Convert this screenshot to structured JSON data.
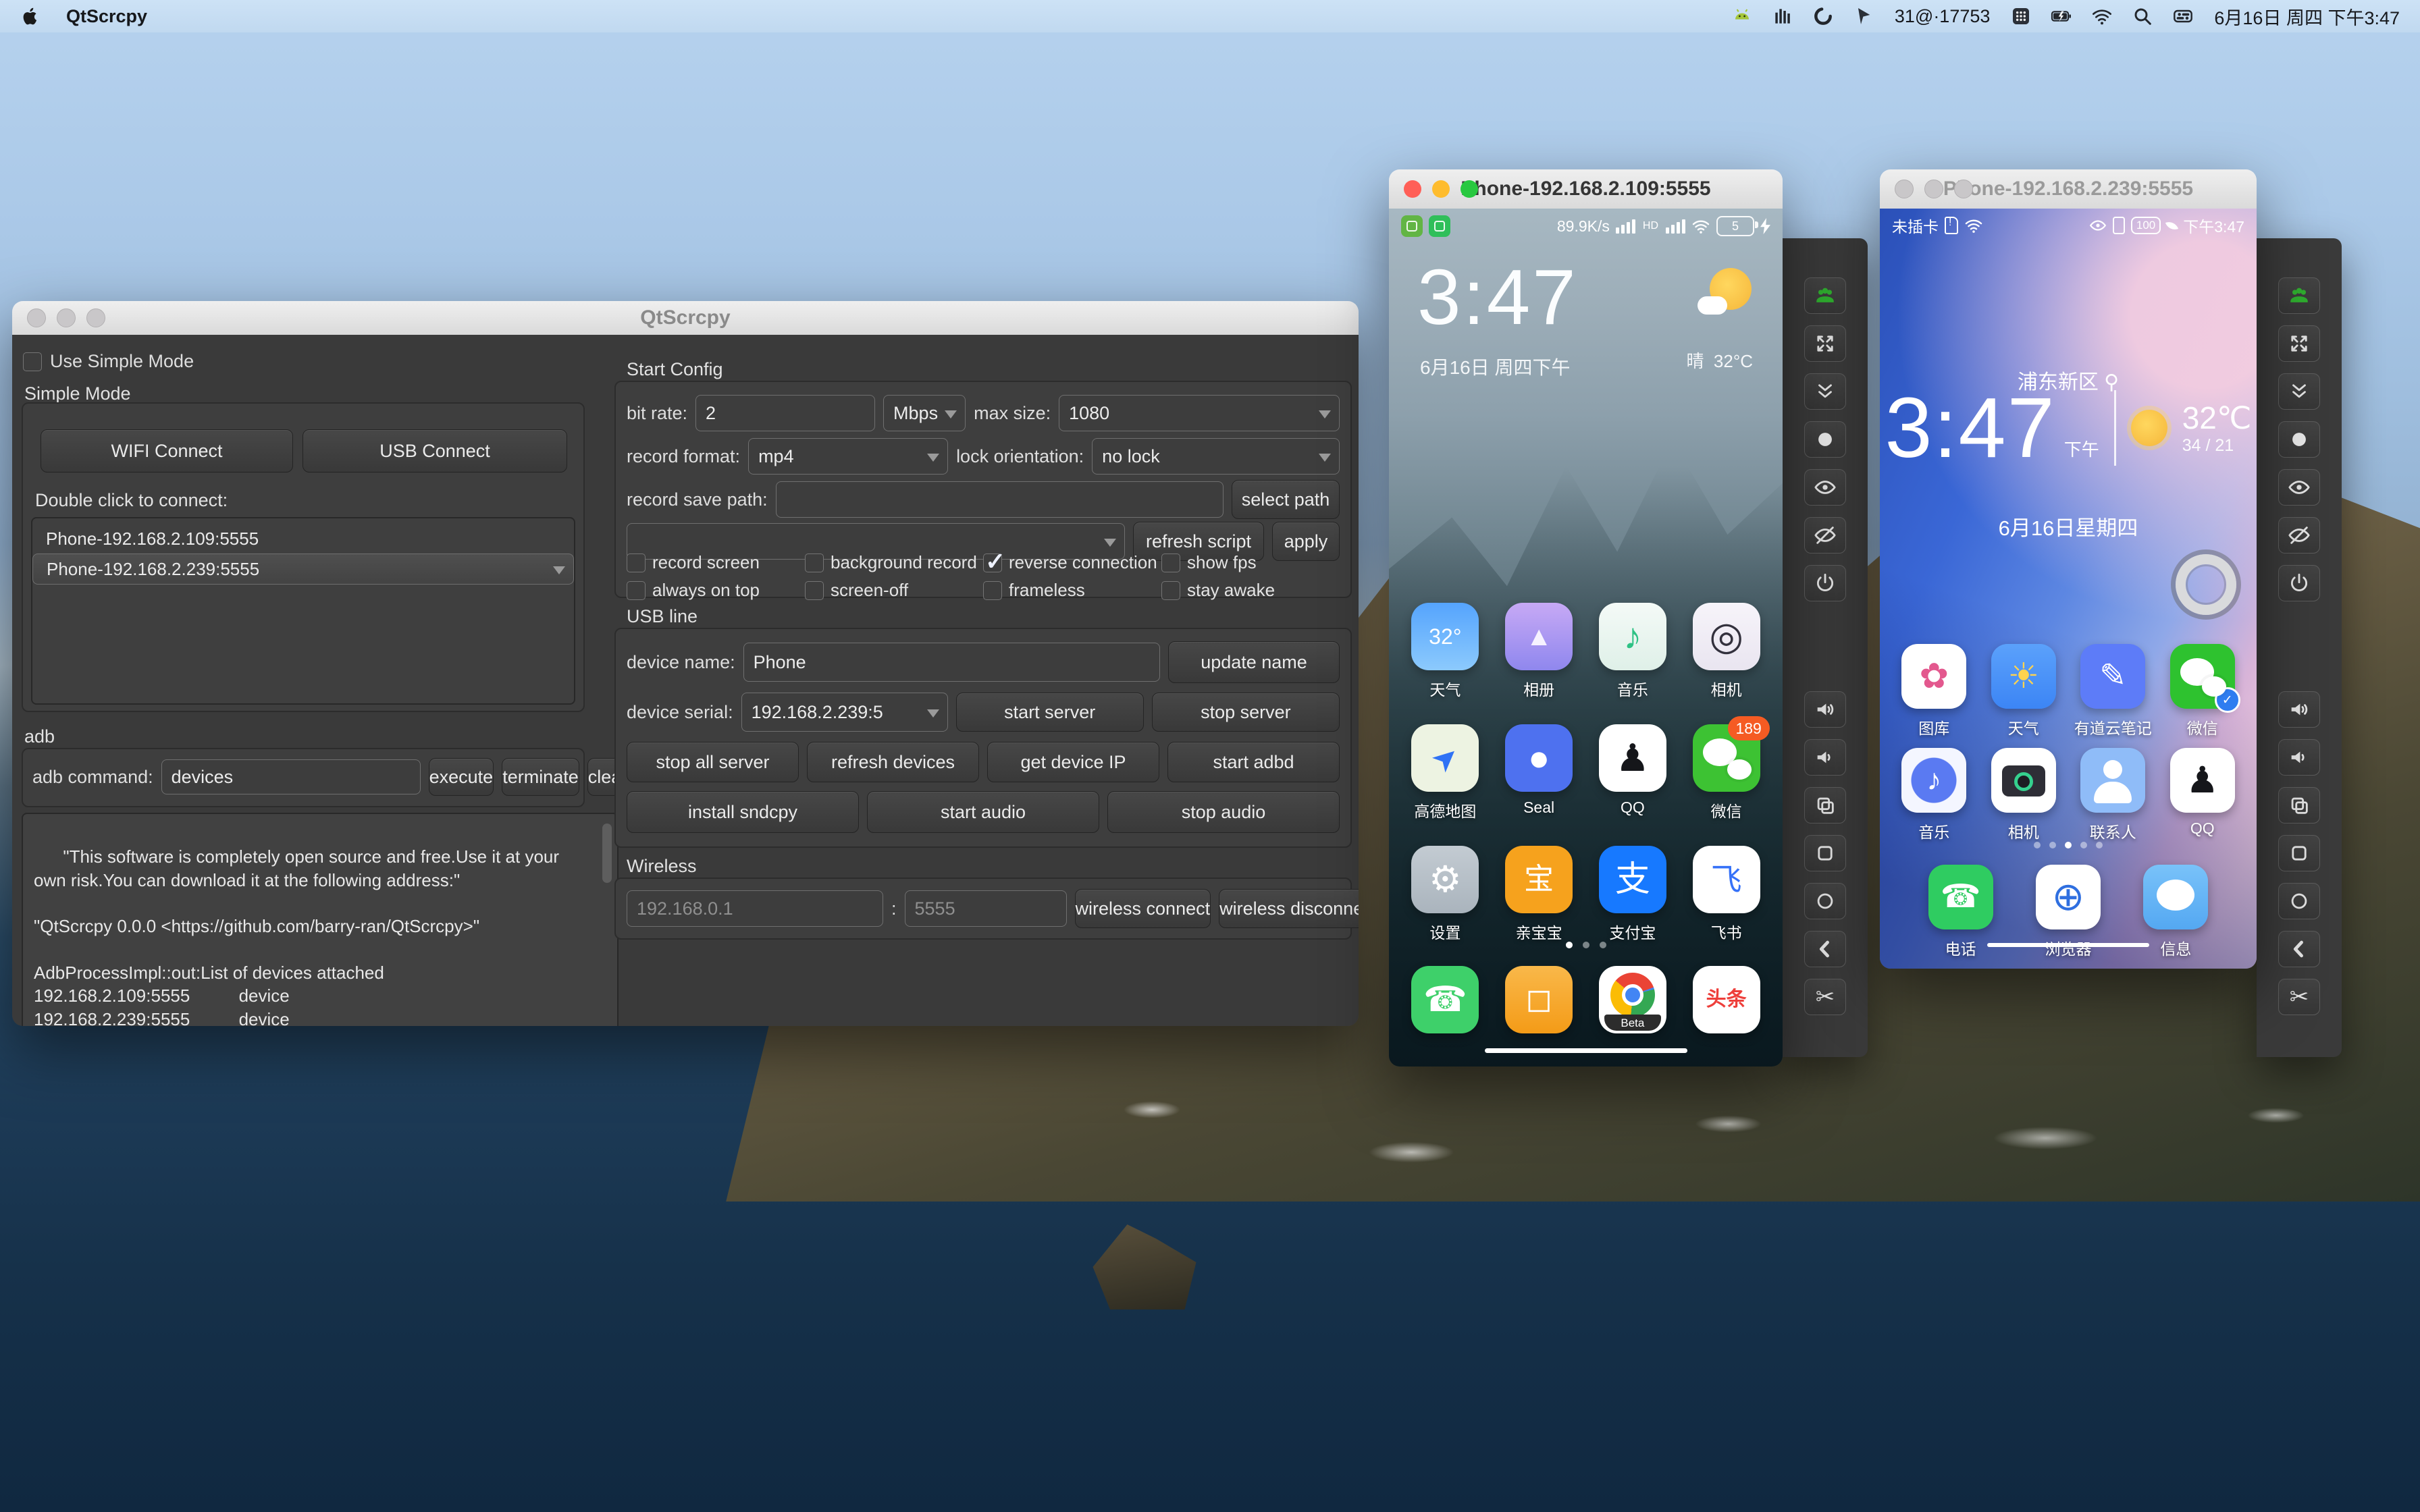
{
  "colors": {
    "traffic_red": "#ff5f57",
    "traffic_yellow": "#febc2e",
    "traffic_green": "#28c840",
    "wechat_green": "#2dc100",
    "panel_dark": "#3a3a3a",
    "menubar_tint": "#c8ddf2"
  },
  "menu_bar": {
    "app_name": "QtScrcpy",
    "proxy_status": "31@·17753",
    "clock": "6月16日 周四 下午3:47",
    "icons_left_of_status": [
      "android-icon",
      "equalizer-icon",
      "swirl-icon",
      "cursor-icon"
    ],
    "icons_right_of_status": [
      "grid-icon",
      "battery-icon",
      "wifi-icon",
      "search-icon",
      "control-center-icon"
    ]
  },
  "main_window": {
    "title": "QtScrcpy",
    "simple": {
      "use_simple_mode": "Use Simple Mode",
      "simple_mode": "Simple Mode",
      "wifi_connect": "WIFI Connect",
      "usb_connect": "USB Connect",
      "double_click": "Double click to connect:",
      "devices": [
        "Phone-192.168.2.109:5555",
        "Phone-192.168.2.239:5555"
      ],
      "selected_index": 1
    },
    "adb": {
      "section": "adb",
      "command_label": "adb command:",
      "command_value": "devices",
      "execute": "execute",
      "terminate": "terminate",
      "clear": "clear",
      "log": [
        "\"This software is completely open source and free.Use it at your own risk.You can download it at the following address:\"",
        "",
        "\"QtScrcpy 0.0.0 <https://github.com/barry-ran/QtScrcpy>\"",
        "",
        "AdbProcessImpl::out:List of devices attached",
        "192.168.2.109:5555          device",
        "192.168.2.239:5555          device"
      ]
    },
    "config": {
      "section": "Start Config",
      "bit_rate_label": "bit rate:",
      "bit_rate": "2",
      "bit_rate_unit": "Mbps",
      "max_size_label": "max size:",
      "max_size": "1080",
      "record_format_label": "record format:",
      "record_format": "mp4",
      "lock_orientation_label": "lock orientation:",
      "lock_orientation": "no lock",
      "record_save_path_label": "record save path:",
      "select_path": "select path",
      "refresh_script": "refresh script",
      "apply": "apply",
      "checks": [
        {
          "label": "record screen",
          "checked": false
        },
        {
          "label": "background record",
          "checked": false
        },
        {
          "label": "reverse connection",
          "checked": true
        },
        {
          "label": "show fps",
          "checked": false
        },
        {
          "label": "always on top",
          "checked": false
        },
        {
          "label": "screen-off",
          "checked": false
        },
        {
          "label": "frameless",
          "checked": false
        },
        {
          "label": "stay awake",
          "checked": false
        }
      ]
    },
    "usb": {
      "section": "USB line",
      "device_name_label": "device name:",
      "device_name": "Phone",
      "update_name": "update name",
      "device_serial_label": "device serial:",
      "device_serial": "192.168.2.239:5",
      "row2_buttons": [
        "start server",
        "stop server"
      ],
      "row3_buttons": [
        "stop all server",
        "refresh devices",
        "get device IP",
        "start adbd"
      ],
      "row4_buttons": [
        "install sndcpy",
        "start audio",
        "stop audio"
      ]
    },
    "wireless": {
      "section": "Wireless",
      "ip_placeholder": "192.168.0.1",
      "port_placeholder": "5555",
      "connect": "wireless connect",
      "disconnect": "wireless disconnect"
    }
  },
  "phone1": {
    "title": "Phone-192.168.2.109:5555",
    "status": {
      "speed": "89.9K/s",
      "hd": "HD",
      "battery": "5"
    },
    "clock": "3:47",
    "date": "6月16日 周四下午",
    "weather_cond": "晴",
    "weather_temp": "32°C",
    "apps": [
      {
        "name": "weather-app-icon",
        "label": "天气",
        "glyph": "32°",
        "bg": "linear-gradient(180deg,#55a4fd,#8ccafd)",
        "fg": "#ffffff",
        "fs": 32
      },
      {
        "name": "gallery-app-icon",
        "label": "相册",
        "glyph": "▲",
        "bg": "linear-gradient(180deg,#c7a9f5,#8f87ee)",
        "fg": "#f6f2ff",
        "fs": 40
      },
      {
        "name": "music-app-icon",
        "label": "音乐",
        "glyph": "♪",
        "bg": "linear-gradient(180deg,#f4faf7,#dff0e8)",
        "fg": "#2fc285",
        "fs": 54
      },
      {
        "name": "camera-app-icon",
        "label": "相机",
        "glyph": "◎",
        "bg": "linear-gradient(180deg,#f7f4fa,#e9e5f0)",
        "fg": "#33313d",
        "fs": 58
      },
      {
        "name": "amap-app-icon",
        "label": "高德地图",
        "glyph": "➤",
        "bg": "#edf3e2",
        "fg": "#2f72f5",
        "fs": 46,
        "cls": "rot"
      },
      {
        "name": "seal-app-icon",
        "label": "Seal",
        "glyph": "●",
        "bg": "#4e71ef",
        "fg": "#ffffff",
        "fs": 54
      },
      {
        "name": "qq-app-icon",
        "label": "QQ",
        "glyph": "♟",
        "bg": "#ffffff",
        "fg": "#15161a",
        "fs": 56
      },
      {
        "name": "wechat-app-icon",
        "label": "微信",
        "bg": "#3dc233",
        "icon_cls": "wechat",
        "badge": "189"
      },
      {
        "name": "settings-app-icon",
        "label": "设置",
        "glyph": "⚙",
        "bg": "linear-gradient(180deg,#c3cbd2,#aab4bd)",
        "fg": "#ffffff",
        "fs": 54
      },
      {
        "name": "qinbaobao-app-icon",
        "label": "亲宝宝",
        "glyph": "宝",
        "bg": "#f6a21d",
        "fg": "#ffffff",
        "fs": 44
      },
      {
        "name": "alipay-app-icon",
        "label": "支付宝",
        "glyph": "支",
        "bg": "#1779ff",
        "fg": "#ffffff",
        "fs": 52
      },
      {
        "name": "feishu-app-icon",
        "label": "飞书",
        "glyph": "飞",
        "bg": "#ffffff",
        "fg": "#3672f8",
        "fs": 46
      }
    ],
    "dock": [
      {
        "name": "phone-app-icon",
        "glyph": "☎",
        "bg": "#3ed06a",
        "fg": "#ffffff",
        "fs": 52
      },
      {
        "name": "notes-app-icon",
        "glyph": "◻",
        "bg": "linear-gradient(180deg,#f9b84a,#f49b17)",
        "fg": "#ffffff",
        "fs": 48
      },
      {
        "name": "chrome-beta-app-icon",
        "glyph": "Beta",
        "bg": "#ffffff",
        "icon_cls": "chrome"
      },
      {
        "name": "toutiao-app-icon",
        "glyph": "头条",
        "bg": "#ffffff",
        "fg": "#ee3f3b",
        "fs": 30,
        "bold": true
      }
    ],
    "dots": {
      "count": 3,
      "active": 0
    }
  },
  "phone2": {
    "title": "Phone-192.168.2.239:5555",
    "status": {
      "no_sim": "未插卡",
      "battery": "100",
      "time": "下午3:47"
    },
    "location": "浦东新区",
    "clock": "3:47",
    "ampm": "下午",
    "temp": "32℃",
    "hilo": "34 / 21",
    "date": "6月16日星期四",
    "apps": [
      {
        "name": "gallery-app-icon",
        "label": "图库",
        "glyph": "✿",
        "bg": "#ffffff",
        "fg": "#e3588e",
        "fs": 52
      },
      {
        "name": "weather-app-icon",
        "label": "天气",
        "glyph": "☀",
        "bg": "linear-gradient(180deg,#5ba1fb,#3c85f5)",
        "fg": "#ffd34f",
        "fs": 52
      },
      {
        "name": "youdao-note-app-icon",
        "label": "有道云笔记",
        "glyph": "✎",
        "bg": "#5d7cf8",
        "fg": "#ffffff",
        "fs": 48
      },
      {
        "name": "wechat-app-icon",
        "label": "微信",
        "bg": "#2ec22f",
        "icon_cls": "wechat",
        "badge": "✓",
        "badge_cls": "check"
      },
      {
        "name": "music-app-icon",
        "label": "音乐",
        "glyph": "♪",
        "bg": "radial-gradient(circle at 50% 50%, #5a7af2 0 33px, #f4f6ff 34px)",
        "fg": "#ffffff",
        "fs": 44
      },
      {
        "name": "camera-app-icon",
        "label": "相机",
        "bg": "#ffffff",
        "icon_cls": "cam2"
      },
      {
        "name": "contacts-app-icon",
        "label": "联系人",
        "bg": "#8fbcf8",
        "icon_cls": "person"
      },
      {
        "name": "qq-app-icon",
        "label": "QQ",
        "glyph": "♟",
        "bg": "#ffffff",
        "fg": "#15161a",
        "fs": 54
      }
    ],
    "dock": [
      {
        "name": "phone-app-icon",
        "label": "电话",
        "glyph": "☎",
        "bg": "#2fcc61",
        "fg": "#ffffff",
        "fs": 48
      },
      {
        "name": "browser-app-icon",
        "label": "浏览器",
        "glyph": "⊕",
        "bg": "#ffffff",
        "fg": "#2f6fe0",
        "fs": 58
      },
      {
        "name": "messages-app-icon",
        "label": "信息",
        "bg": "linear-gradient(180deg,#79c2f9,#54a8f2)",
        "icon_cls": "bubble"
      }
    ],
    "dots": {
      "count": 5,
      "active": 2
    }
  },
  "toolbar": {
    "buttons": [
      "group-icon",
      "fullscreen-icon",
      "double-chevron-down-icon",
      "dot-icon",
      "eye-icon",
      "eye-off-icon",
      "power-icon",
      "volume-up-icon",
      "volume-down-icon",
      "copy-icon",
      "square-icon",
      "circle-icon",
      "back-icon",
      "scissors-icon"
    ]
  }
}
